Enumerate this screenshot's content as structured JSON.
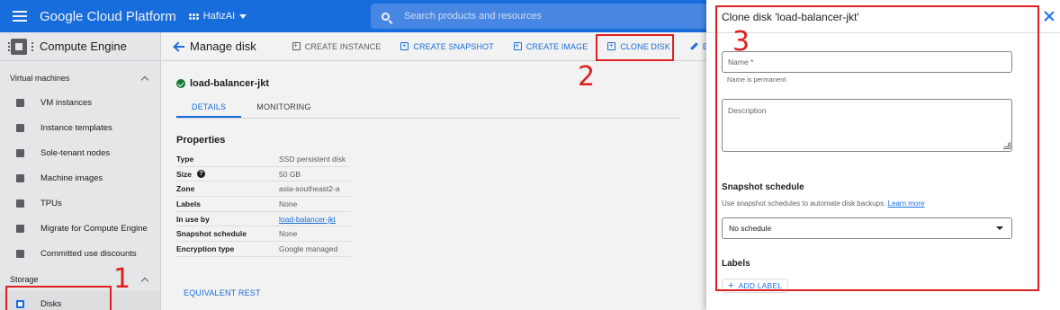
{
  "topbar": {
    "brand": "Google Cloud Platform",
    "project": "HafizAI",
    "search_placeholder": "Search products and resources"
  },
  "sidebar": {
    "title": "Compute Engine",
    "vm_section": "Virtual machines",
    "vm_items": [
      {
        "label": "VM instances",
        "icon": "vm-instances-icon"
      },
      {
        "label": "Instance templates",
        "icon": "instance-templates-icon"
      },
      {
        "label": "Sole-tenant nodes",
        "icon": "sole-tenant-icon"
      },
      {
        "label": "Machine images",
        "icon": "machine-images-icon"
      },
      {
        "label": "TPUs",
        "icon": "tpu-icon"
      },
      {
        "label": "Migrate for Compute Engine",
        "icon": "migrate-icon"
      },
      {
        "label": "Committed use discounts",
        "icon": "discount-icon"
      }
    ],
    "storage_section": "Storage",
    "storage_items": [
      {
        "label": "Disks",
        "icon": "disk-icon"
      }
    ]
  },
  "main": {
    "page_title": "Manage disk",
    "actions": {
      "create_instance": "CREATE INSTANCE",
      "create_snapshot": "CREATE SNAPSHOT",
      "create_image": "CREATE IMAGE",
      "clone_disk": "CLONE DISK",
      "edit": "ED"
    },
    "disk_name": "load-balancer-jkt",
    "tabs": [
      "DETAILS",
      "MONITORING"
    ],
    "properties_title": "Properties",
    "properties": [
      {
        "key": "Type",
        "value": "SSD persistent disk"
      },
      {
        "key": "Size",
        "value": "50 GB"
      },
      {
        "key": "Zone",
        "value": "asia-southeast2-a"
      },
      {
        "key": "Labels",
        "value": "None"
      },
      {
        "key": "In use by",
        "value": "load-balancer-jkt"
      },
      {
        "key": "Snapshot schedule",
        "value": "None"
      },
      {
        "key": "Encryption type",
        "value": "Google managed"
      }
    ],
    "equivalent_rest": "EQUIVALENT REST"
  },
  "panel": {
    "title": "Clone disk 'load-balancer-jkt'",
    "name_placeholder": "Name *",
    "name_hint": "Name is permanent",
    "description_placeholder": "Description",
    "snapshot_title": "Snapshot schedule",
    "snapshot_desc": "Use snapshot schedules to automate disk backups.",
    "learn_more": "Learn more",
    "schedule_value": "No schedule",
    "labels_title": "Labels",
    "add_label": "ADD LABEL"
  },
  "annotations": {
    "one": "1",
    "two": "2",
    "three": "3",
    "color": "#e02020"
  },
  "colors": {
    "accent": "#1a73e8",
    "success": "#188038"
  }
}
